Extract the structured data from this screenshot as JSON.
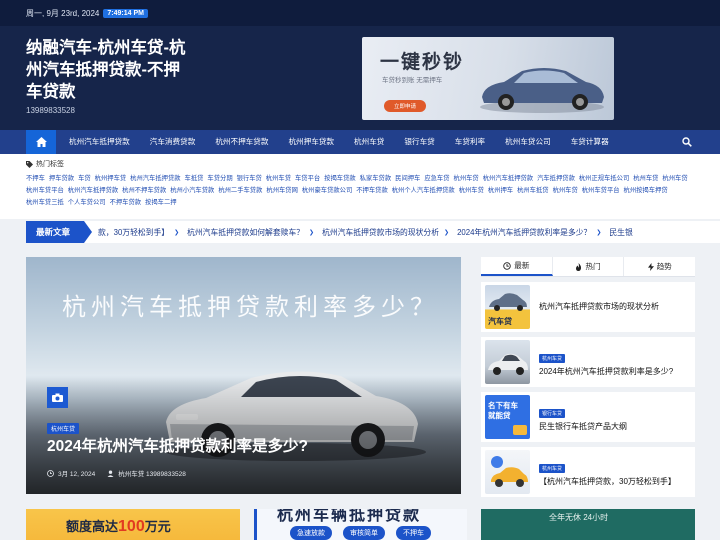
{
  "topbar": {
    "date": "周一, 9月 23rd, 2024",
    "time": "7:49:14 PM"
  },
  "site": {
    "title": "纳融汽车-杭州车贷-杭州汽车抵押贷款-不押车贷款",
    "phone": "13989833528"
  },
  "banner": {
    "title": "一键秒钞",
    "subtitle": "车贷秒到账  无需押车",
    "button": "立即申请"
  },
  "nav": {
    "home_icon": "home-icon",
    "items": [
      "杭州汽车抵押贷款",
      "汽车消费贷款",
      "杭州不押车贷款",
      "杭州押车贷款",
      "杭州车贷",
      "银行车贷",
      "车贷利率",
      "杭州车贷公司",
      "车贷计算器"
    ],
    "search_icon": "search-icon"
  },
  "tags": {
    "heading": "热门标签",
    "items": [
      "不押车",
      "押车贷款",
      "车贷",
      "杭州押车贷",
      "杭州汽车抵押贷款",
      "车抵贷",
      "车贷分期",
      "银行车贷",
      "杭州车贷",
      "车贷平台",
      "按揭车贷款",
      "私家车贷款",
      "民间押车",
      "应急车贷",
      "杭州车贷",
      "杭州汽车抵押贷款",
      "汽车抵押贷款",
      "杭州正规车抵公司",
      "杭州车贷",
      "杭州车贷",
      "杭州车贷平台",
      "杭州汽车抵押贷款",
      "杭州不押车贷款",
      "杭州小汽车贷款",
      "杭州二手车贷款",
      "杭州车贷网",
      "杭州豪车贷款公司",
      "不押车贷款",
      "杭州个人汽车抵押贷款",
      "杭州车贷",
      "杭州押车",
      "杭州车抵贷",
      "杭州车贷",
      "杭州车贷平台",
      "杭州按揭车押贷",
      "杭州车贷三抵",
      "个人车贷公司",
      "不押车贷款",
      "按揭车二押"
    ]
  },
  "ticker": {
    "label": "最新文章",
    "items": [
      "款，30万轻松到手】",
      "杭州汽车抵押贷款如何解套赎车？",
      "杭州汽车抵押贷款市场的现状分析",
      "2024年杭州汽车抵押贷款利率是多少？",
      "民生银"
    ]
  },
  "hero": {
    "headline": "杭州汽车抵押贷款利率多少？",
    "category": "杭州车贷",
    "title": "2024年杭州汽车抵押贷款利率是多少?",
    "date": "3月 12, 2024",
    "author": "杭州车贷 13989833528"
  },
  "sidebar": {
    "tabs": [
      {
        "label": "最新",
        "icon": "clock-icon"
      },
      {
        "label": "热门",
        "icon": "fire-icon"
      },
      {
        "label": "趋势",
        "icon": "bolt-icon"
      }
    ],
    "items": [
      {
        "category": "",
        "title": "杭州汽车抵押贷款市场的现状分析",
        "thumb_text": "汽车贷"
      },
      {
        "category": "杭州车贷",
        "title": "2024年杭州汽车抵押贷款利率是多少?",
        "thumb_text": ""
      },
      {
        "category": "银行车贷",
        "title": "民生银行车抵贷产品大纲",
        "thumb_text": "名下有车\n就能贷"
      },
      {
        "category": "杭州车贷",
        "title": "【杭州汽车抵押贷款，30万轻松到手】",
        "thumb_text": ""
      }
    ]
  },
  "bottom": {
    "ad1_text": "额度高达",
    "ad1_amount": "100",
    "ad1_unit": "万元",
    "ad2_heading": "杭州车辆抵押贷款",
    "ad2_pills": [
      "急速放款",
      "审核简单",
      "不押车"
    ],
    "ad3_text": "全年无休 24小时"
  },
  "colors": {
    "accent": "#1c53c9",
    "header": "#16254a",
    "nav": "#22408c"
  }
}
